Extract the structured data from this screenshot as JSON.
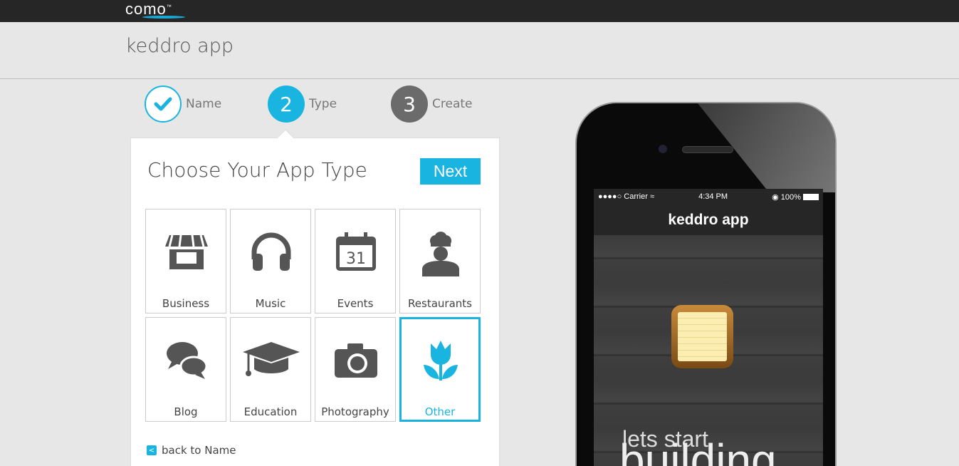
{
  "topbar": {
    "logo": "como",
    "tm": "™"
  },
  "header": {
    "app_name": "keddro app"
  },
  "steps": [
    {
      "number": "✓",
      "label": "Name",
      "state": "done"
    },
    {
      "number": "2",
      "label": "Type",
      "state": "active"
    },
    {
      "number": "3",
      "label": "Create",
      "state": "pending"
    }
  ],
  "panel": {
    "title": "Choose Your App Type",
    "next_label": "Next",
    "back_label": "back to Name",
    "types": [
      {
        "label": "Business",
        "icon": "storefront-icon"
      },
      {
        "label": "Music",
        "icon": "headphones-icon"
      },
      {
        "label": "Events",
        "icon": "calendar-icon",
        "day": "31"
      },
      {
        "label": "Restaurants",
        "icon": "chef-icon"
      },
      {
        "label": "Blog",
        "icon": "chat-bubbles-icon"
      },
      {
        "label": "Education",
        "icon": "graduation-cap-icon"
      },
      {
        "label": "Photography",
        "icon": "camera-icon"
      },
      {
        "label": "Other",
        "icon": "tulip-icon",
        "selected": true
      }
    ]
  },
  "phone": {
    "carrier": "●●●●○ Carrier",
    "time": "4:34 PM",
    "battery": "100%",
    "app_title": "keddro app",
    "tagline1": "lets start",
    "tagline2": "building"
  },
  "colors": {
    "accent": "#1ab4e0",
    "topbar": "#262626",
    "step_pending": "#6b6b6b"
  }
}
